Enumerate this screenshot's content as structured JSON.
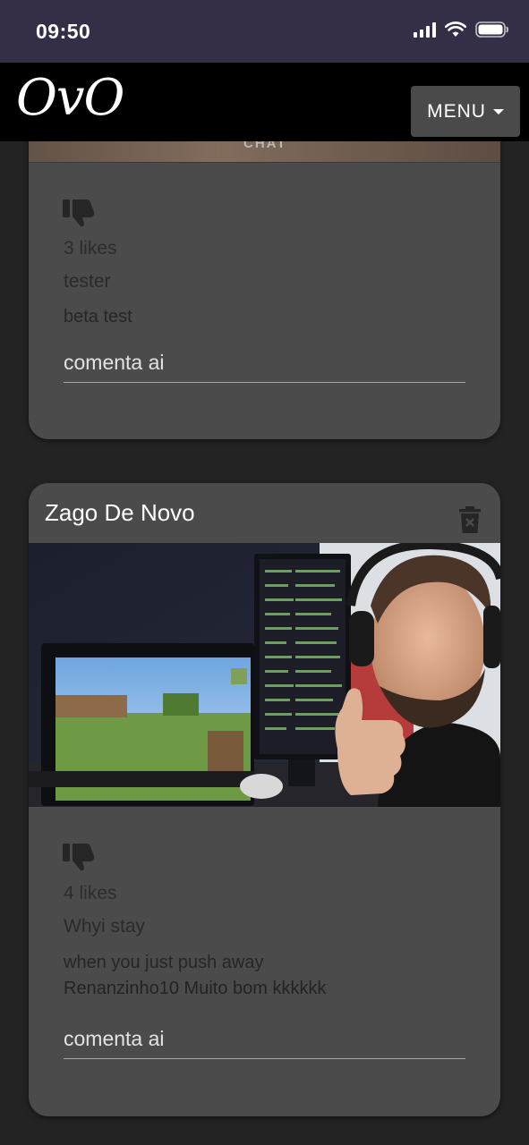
{
  "status_bar": {
    "time": "09:50"
  },
  "navbar": {
    "brand": "OvO",
    "menu_label": "MENU"
  },
  "posts": [
    {
      "image_text": "CHAT",
      "likes": "3 likes",
      "author": "tester",
      "caption": "beta test",
      "comment_placeholder": "comenta ai"
    },
    {
      "title": "Zago De Novo",
      "likes": "4 likes",
      "author": "Whyi stay",
      "caption": "when you just push away",
      "comments": [
        {
          "text": "Renanzinho10 Muito bom kkkkkk"
        }
      ],
      "comment_placeholder": "comenta ai"
    }
  ],
  "colors": {
    "status_bar_bg": "#342f47",
    "navbar_bg": "#000000",
    "page_bg": "#232323",
    "card_bg": "#4b4b4b",
    "menu_button_bg": "#4a4a4a"
  }
}
